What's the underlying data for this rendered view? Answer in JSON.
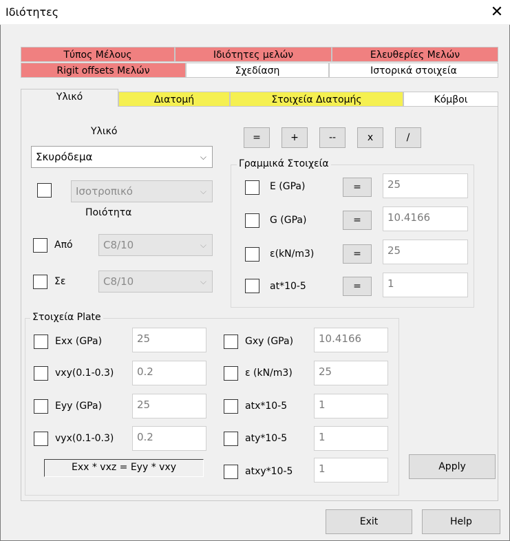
{
  "window": {
    "title": "Ιδιότητες",
    "close_glyph": "✕"
  },
  "tabs_row1": [
    "Τύπος Μέλους",
    "Ιδιότητες μελών",
    "Ελευθερίες Μελών"
  ],
  "tabs_row2": [
    "Rigit offsets Μελών",
    "Σχεδίαση",
    "Ιστορικά στοιχεία"
  ],
  "tabs_row3": [
    "Υλικό",
    "Διατομή",
    "Στοιχεία Διατομής",
    "Κόμβοι"
  ],
  "colors": {
    "tab_red": "#f08080",
    "tab_yellow": "#f5f051"
  },
  "material": {
    "label": "Υλικό",
    "value": "Σκυρόδεμα",
    "isotropy": "Ισοτροπικό",
    "quality_label": "Ποιότητα",
    "from_label": "Από",
    "from_value": "C8/10",
    "to_label": "Σε",
    "to_value": "C8/10"
  },
  "ops": [
    "=",
    "+",
    "--",
    "x",
    "/"
  ],
  "linear": {
    "title": "Γραμμικά Στοιχεία",
    "eq": "=",
    "rows": [
      {
        "label": "E (GPa)",
        "value": "25"
      },
      {
        "label": "G (GPa)",
        "value": "10.4166"
      },
      {
        "label": "ε(kN/m3)",
        "value": "25"
      },
      {
        "label": "at*10-5",
        "value": "1"
      }
    ]
  },
  "plate": {
    "title": "Στοιχεία Plate",
    "left": [
      {
        "label": "Exx (GPa)",
        "value": "25"
      },
      {
        "label": "vxy(0.1-0.3)",
        "value": "0.2"
      },
      {
        "label": "Eyy (GPa)",
        "value": "25"
      },
      {
        "label": "vyx(0.1-0.3)",
        "value": "0.2"
      }
    ],
    "right": [
      {
        "label": "Gxy (GPa)",
        "value": "10.4166"
      },
      {
        "label": "ε (kN/m3)",
        "value": "25"
      },
      {
        "label": "atx*10-5",
        "value": "1"
      },
      {
        "label": "aty*10-5",
        "value": "1"
      },
      {
        "label": "atxy*10-5",
        "value": "1"
      }
    ],
    "formula": "Exx * vxz = Eyy * vxy"
  },
  "buttons": {
    "apply": "Apply",
    "exit": "Exit",
    "help": "Help"
  }
}
